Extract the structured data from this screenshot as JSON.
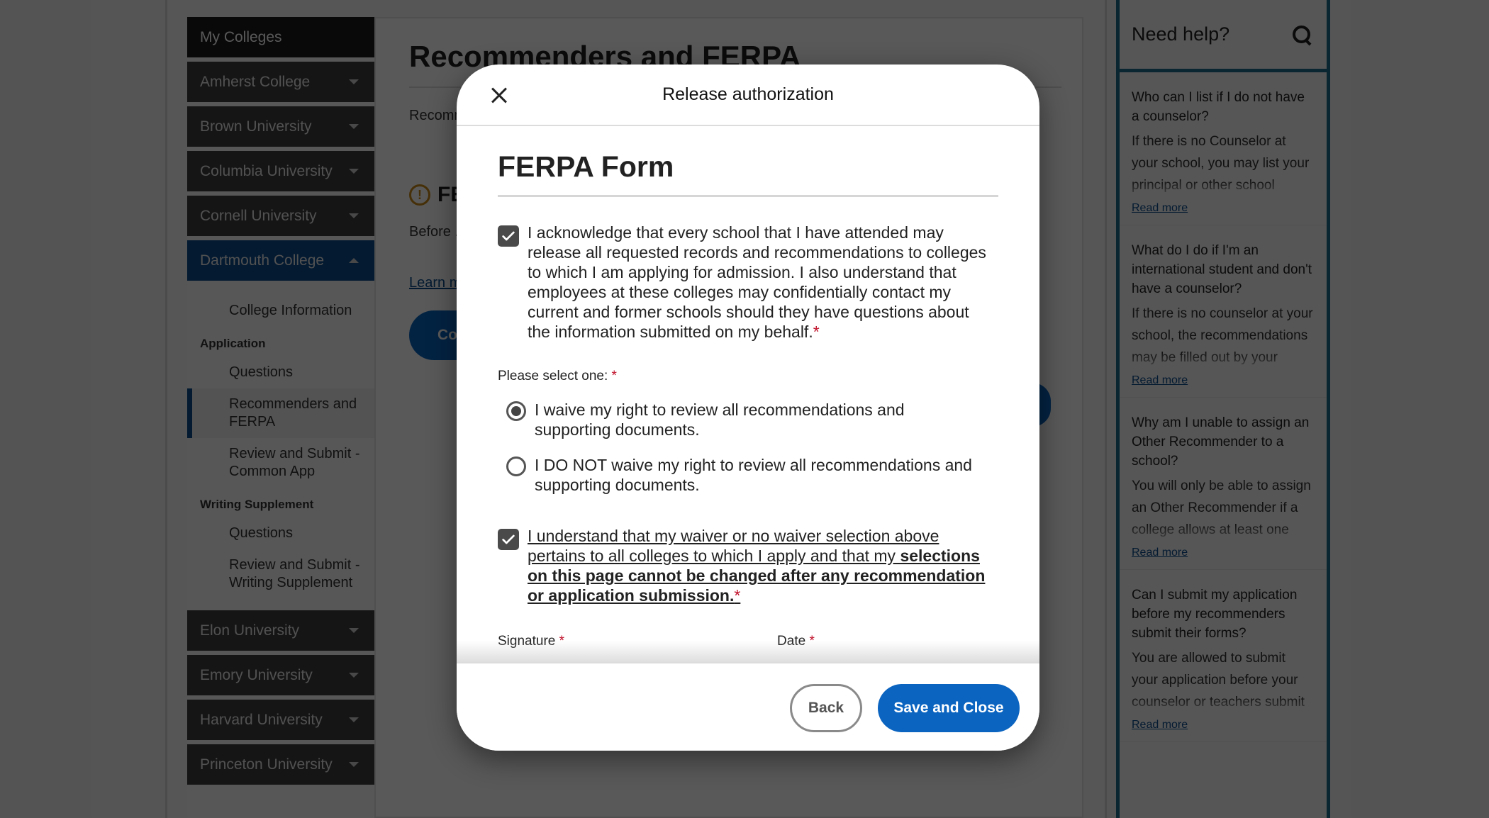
{
  "sidebar": {
    "header": "My Colleges",
    "colleges_before": [
      {
        "label": "Amherst College"
      },
      {
        "label": "Brown University"
      },
      {
        "label": "Columbia University"
      },
      {
        "label": "Cornell University"
      }
    ],
    "active_college": {
      "label": "Dartmouth College",
      "links": {
        "college_information": "College Information",
        "application_section": "Application",
        "application_questions": "Questions",
        "recommenders": "Recommenders and FERPA",
        "review_common_app": "Review and Submit - Common App",
        "writing_section": "Writing Supplement",
        "writing_questions": "Questions",
        "review_writing": "Review and Submit - Writing Supplement"
      }
    },
    "colleges_after": [
      {
        "label": "Elon University"
      },
      {
        "label": "Emory University"
      },
      {
        "label": "Harvard University"
      },
      {
        "label": "Princeton University"
      }
    ]
  },
  "main": {
    "title": "Recommenders and FERPA",
    "intro": "Recommenders and FERPA. Colleges to which r...",
    "warning_title": "FERPA",
    "warning_body": "Before ... complete ...",
    "learn_more": "Learn more",
    "continue_button": "Continue"
  },
  "help": {
    "title": "Need help?",
    "faqs": [
      {
        "question": "Who can I list if I do not have a counselor?",
        "answer": "If there is no Counselor at your school, you may list your principal or other school official. International",
        "read_more": "Read more"
      },
      {
        "question": "What do I do if I'm an international student and don't have a counselor?",
        "answer": "If there is no counselor at your school, the recommendations may be filled out by your principal",
        "read_more": "Read more"
      },
      {
        "question": "Why am I unable to assign an Other Recommender to a school?",
        "answer": "You will only be able to assign an Other Recommender if a college allows at least one type of",
        "read_more": "Read more"
      },
      {
        "question": "Can I submit my application before my recommenders submit their forms?",
        "answer": "You are allowed to submit your application before your counselor or teachers submit their school forms",
        "read_more": "Read more"
      }
    ]
  },
  "modal": {
    "title": "Release authorization",
    "form_title": "FERPA Form",
    "acknowledge": {
      "checked": true,
      "text": "I acknowledge that every school that I have attended may release all requested records and recommendations to colleges to which I am applying for admission. I also understand that employees at these colleges may confidentially contact my current and former schools should they have questions about the information submitted on my behalf.",
      "required_mark": "*"
    },
    "select_label": "Please select one:",
    "select_required_mark": "*",
    "waiver_options": [
      {
        "label": "I waive my right to review all recommendations and supporting documents.",
        "selected": true
      },
      {
        "label": "I DO NOT waive my right to review all recommendations and supporting documents.",
        "selected": false
      }
    ],
    "understand": {
      "checked": true,
      "text_plain": "I understand that my waiver or no waiver selection above pertains to all colleges to which I apply and that my ",
      "text_bold": "selections on this page cannot be changed after any recommendation or application submission.",
      "required_mark": "*"
    },
    "signature_label": "Signature",
    "date_label": "Date",
    "back_button": "Back",
    "save_button": "Save and Close"
  }
}
